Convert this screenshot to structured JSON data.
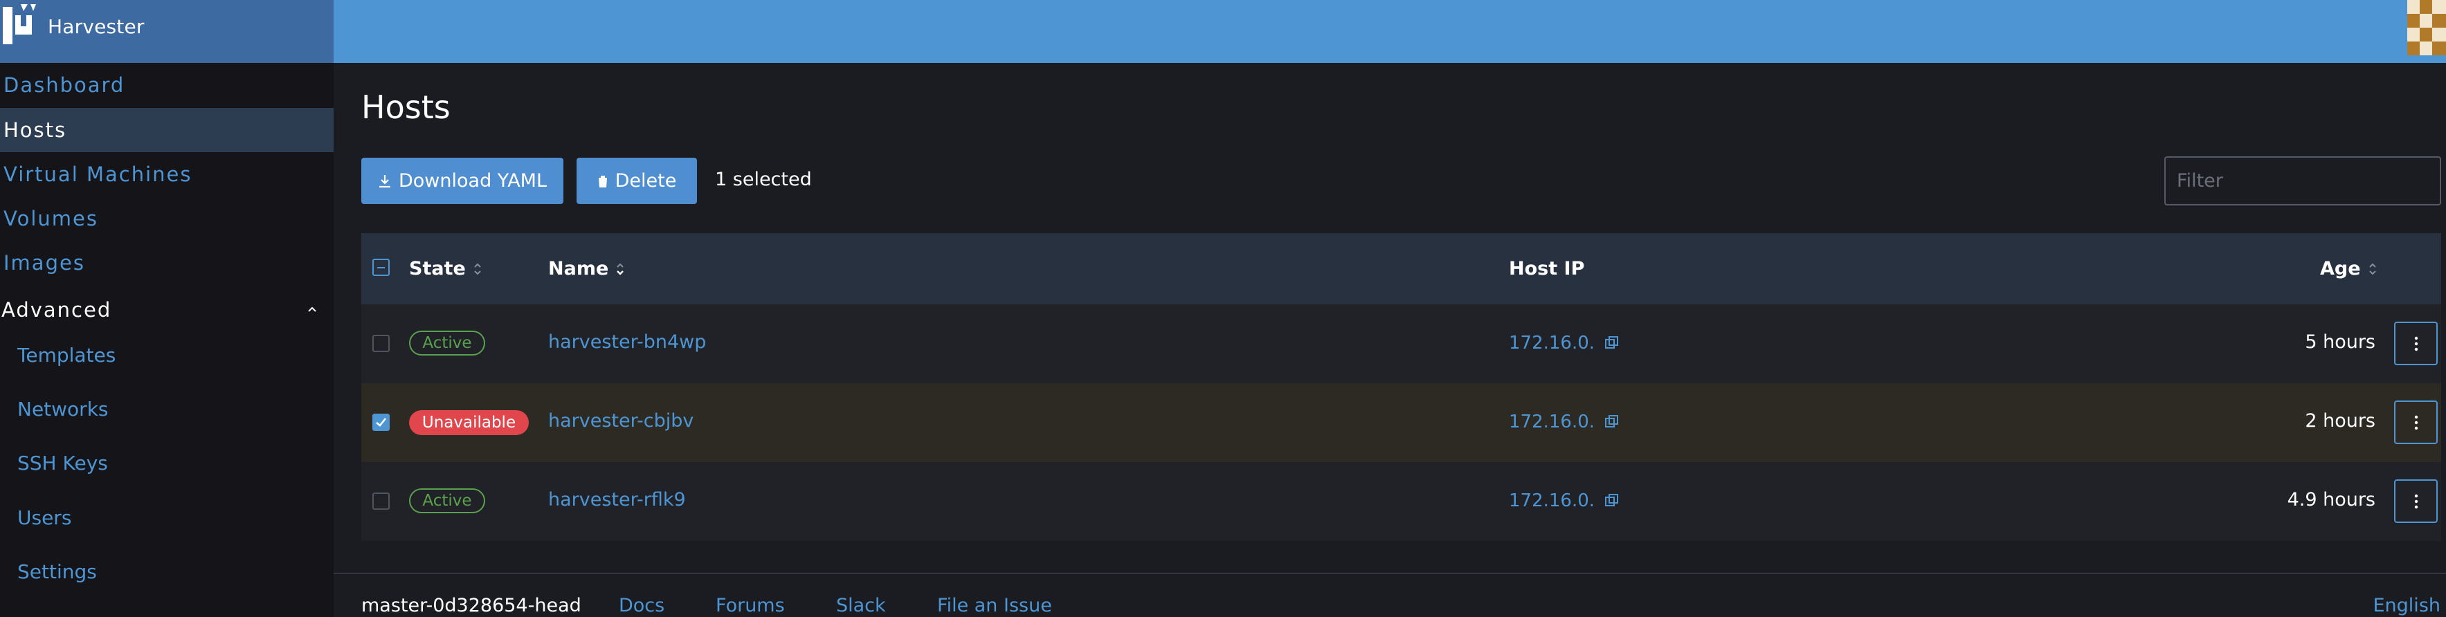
{
  "app": {
    "name": "Harvester"
  },
  "sidebar": {
    "items": [
      {
        "label": "Dashboard"
      },
      {
        "label": "Hosts"
      },
      {
        "label": "Virtual Machines"
      },
      {
        "label": "Volumes"
      },
      {
        "label": "Images"
      }
    ],
    "group": {
      "label": "Advanced",
      "items": [
        {
          "label": "Templates"
        },
        {
          "label": "Networks"
        },
        {
          "label": "SSH Keys"
        },
        {
          "label": "Users"
        },
        {
          "label": "Settings"
        }
      ]
    }
  },
  "page": {
    "title": "Hosts",
    "actions": {
      "download_label": "Download YAML",
      "delete_label": "Delete",
      "selected_text": "1 selected"
    },
    "filter_placeholder": "Filter"
  },
  "table": {
    "columns": {
      "state": "State",
      "name": "Name",
      "host_ip": "Host IP",
      "age": "Age"
    },
    "rows": [
      {
        "state": "Active",
        "name": "harvester-bn4wp",
        "host_ip": "172.16.0.",
        "age": "5 hours",
        "selected": false
      },
      {
        "state": "Unavailable",
        "name": "harvester-cbjbv",
        "host_ip": "172.16.0.",
        "age": "2 hours",
        "selected": true
      },
      {
        "state": "Active",
        "name": "harvester-rflk9",
        "host_ip": "172.16.0.",
        "age": "4.9 hours",
        "selected": false
      }
    ]
  },
  "footer": {
    "version": "master-0d328654-head",
    "links": [
      "Docs",
      "Forums",
      "Slack",
      "File an Issue"
    ],
    "language": "English"
  },
  "colors": {
    "accent": "#4d95d3",
    "active": "#5aa14e",
    "unavailable": "#e0464c"
  }
}
